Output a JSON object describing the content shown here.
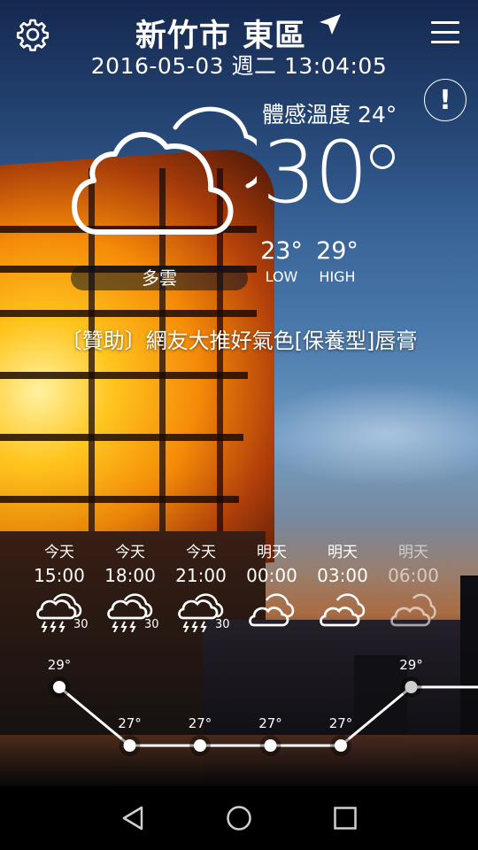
{
  "header": {
    "location": "新竹市 東區",
    "datetime": "2016-05-03 週二 13:04:05",
    "settings_icon": "gear-icon",
    "menu_icon": "hamburger-menu-icon",
    "location_icon": "location-arrow-icon",
    "alert_label": "!"
  },
  "current": {
    "feels_like": "體感溫度 24°",
    "temperature": "30",
    "condition": "多雲",
    "low_value": "23°",
    "low_label": "LOW",
    "high_value": "29°",
    "high_label": "HIGH",
    "condition_icon": "cloud-outline-icon"
  },
  "ad_text": "〔贊助〕網友大推好氣色[保養型]唇膏",
  "hourly": [
    {
      "day": "今天",
      "time": "15:00",
      "icon": "thunderstorm-icon",
      "pop": "30"
    },
    {
      "day": "今天",
      "time": "18:00",
      "icon": "thunderstorm-icon",
      "pop": "30"
    },
    {
      "day": "今天",
      "time": "21:00",
      "icon": "thunderstorm-icon",
      "pop": "30"
    },
    {
      "day": "明天",
      "time": "00:00",
      "icon": "cloudy-icon",
      "pop": ""
    },
    {
      "day": "明天",
      "time": "03:00",
      "icon": "cloudy-icon",
      "pop": ""
    },
    {
      "day": "明天",
      "time": "06:00",
      "icon": "partly-cloudy-icon",
      "pop": ""
    }
  ],
  "chart_data": {
    "type": "line",
    "x": [
      "15:00",
      "18:00",
      "21:00",
      "00:00",
      "03:00",
      "06:00"
    ],
    "series": [
      {
        "values": [
          29,
          27,
          27,
          27,
          27,
          29
        ]
      }
    ],
    "labels": [
      "29°",
      "27°",
      "27°",
      "27°",
      "27°",
      "29°"
    ]
  },
  "navbar": {
    "back_icon": "back-triangle-icon",
    "home_icon": "home-circle-icon",
    "recents_icon": "recents-square-icon"
  },
  "colors": {
    "text": "#ffffff",
    "navbar": "#000000",
    "building_glow": "#f5a21a",
    "sky": "#3d6aa0"
  }
}
